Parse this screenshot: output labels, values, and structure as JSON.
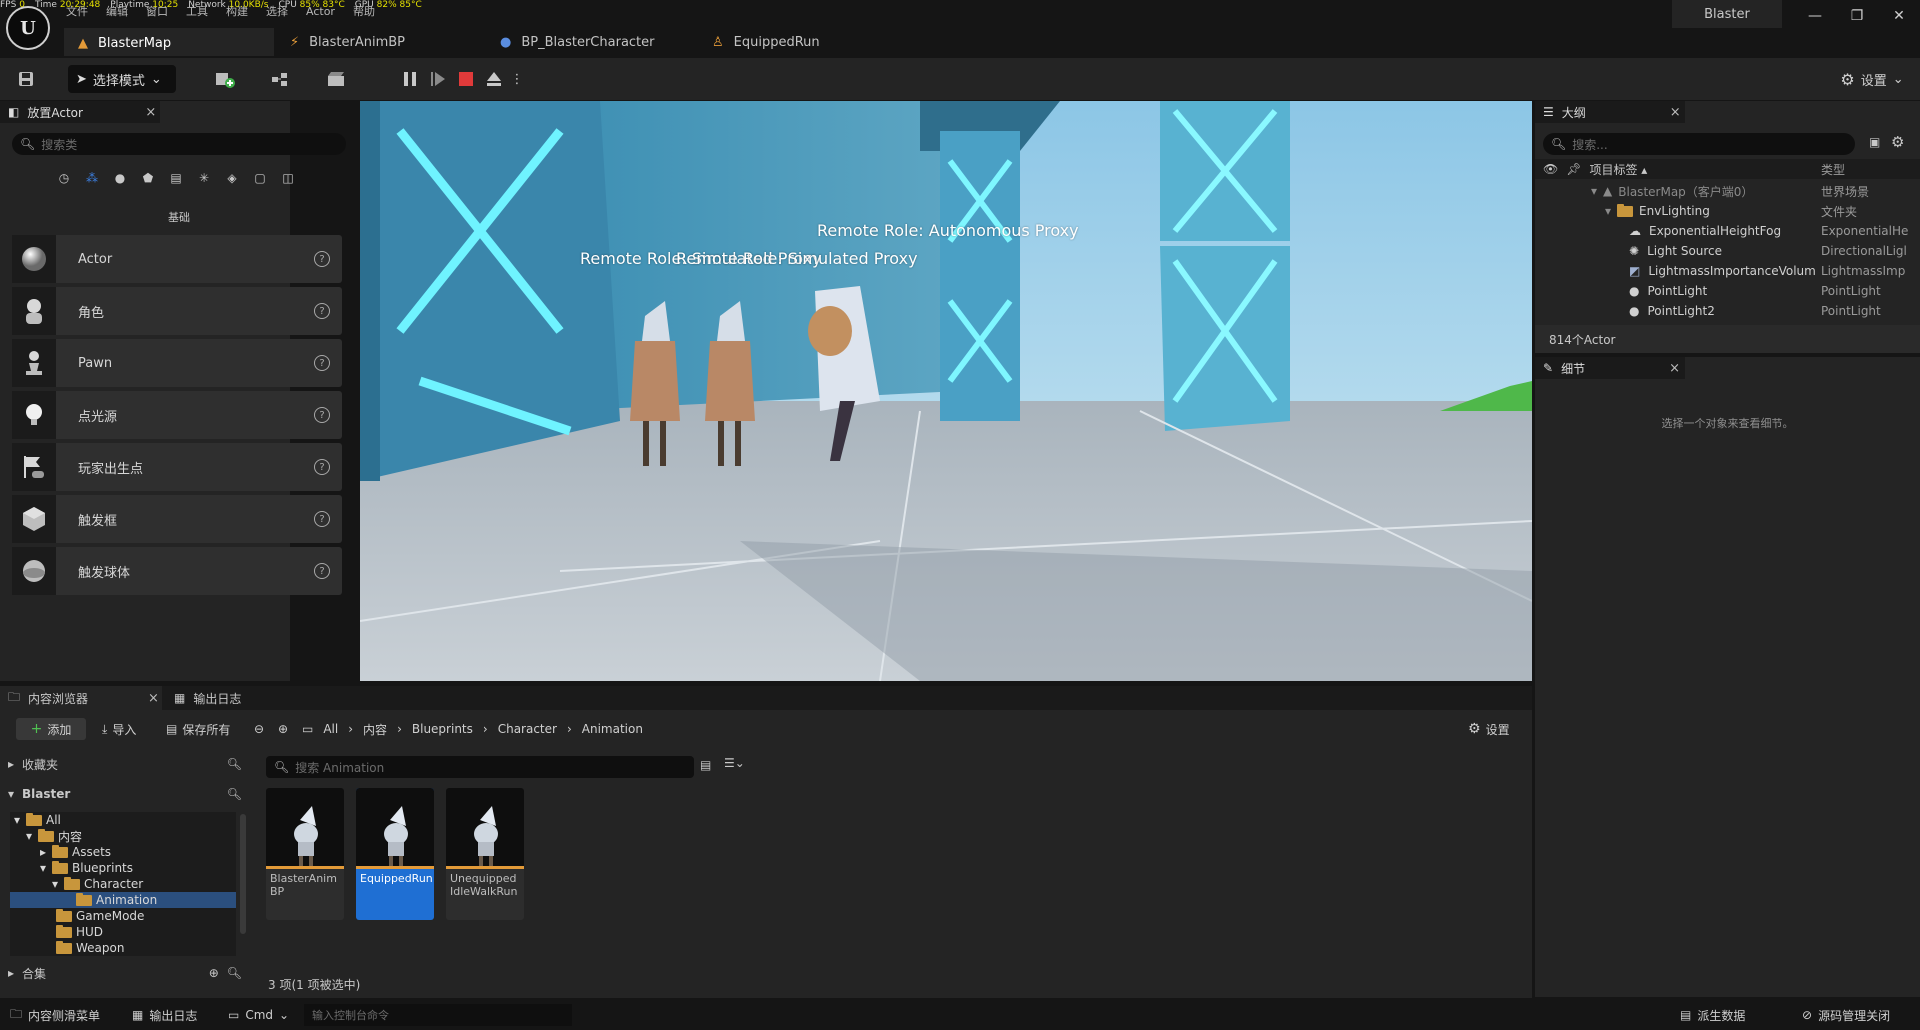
{
  "stats": [
    {
      "label": "FPS",
      "value": "0"
    },
    {
      "label": "Time",
      "value": "20:29:48"
    },
    {
      "label": "Playtime",
      "value": "10:25"
    },
    {
      "label": "Network",
      "value": "10.0KB/s"
    },
    {
      "label": "CPU",
      "value": "85% 83°C"
    },
    {
      "label": "GPU",
      "value": "82% 85°C"
    }
  ],
  "menu": [
    "文件",
    "编辑",
    "窗口",
    "工具",
    "构建",
    "选择",
    "Actor",
    "帮助"
  ],
  "project_name": "Blaster",
  "tabs": [
    {
      "label": "BlasterMap",
      "active": true
    },
    {
      "label": "BlasterAnimBP",
      "active": false
    },
    {
      "label": "BP_BlasterCharacter",
      "active": false
    },
    {
      "label": "EquippedRun",
      "active": false
    }
  ],
  "toolbar": {
    "mode_label": "选择模式",
    "settings_label": "设置"
  },
  "place_actors": {
    "title": "放置Actor",
    "search_placeholder": "搜索类",
    "category_label": "基础",
    "items": [
      {
        "label": "Actor",
        "icon": "sphere-icon"
      },
      {
        "label": "角色",
        "icon": "character-icon"
      },
      {
        "label": "Pawn",
        "icon": "pawn-icon"
      },
      {
        "label": "点光源",
        "icon": "light-bulb-icon"
      },
      {
        "label": "玩家出生点",
        "icon": "player-start-icon"
      },
      {
        "label": "触发框",
        "icon": "trigger-box-icon"
      },
      {
        "label": "触发球体",
        "icon": "trigger-sphere-icon"
      }
    ]
  },
  "viewport": {
    "labels": [
      "Remote Role: Autonomous Proxy",
      "Remote Role: Simulated Proxy",
      "Remote Role: Simulated Proxy"
    ]
  },
  "outliner": {
    "title": "大纲",
    "search_placeholder": "搜索...",
    "col_label": "项目标签 ▴",
    "col_type": "类型",
    "rows": [
      {
        "label": "BlasterMap（客户端0）",
        "type": "世界场景",
        "indent": 0,
        "icon": "map-icon"
      },
      {
        "label": "EnvLighting",
        "type": "文件夹",
        "indent": 1,
        "icon": "folder-icon"
      },
      {
        "label": "ExponentialHeightFog",
        "type": "ExponentialHe",
        "indent": 2,
        "icon": "fog-icon"
      },
      {
        "label": "Light Source",
        "type": "DirectionalLigl",
        "indent": 2,
        "icon": "sun-icon"
      },
      {
        "label": "LightmassImportanceVolum",
        "type": "LightmassImp",
        "indent": 2,
        "icon": "volume-icon"
      },
      {
        "label": "PointLight",
        "type": "PointLight",
        "indent": 2,
        "icon": "light-bulb-icon"
      },
      {
        "label": "PointLight2",
        "type": "PointLight",
        "indent": 2,
        "icon": "light-bulb-icon"
      }
    ],
    "actor_count": "814个Actor"
  },
  "details": {
    "title": "细节",
    "hint": "选择一个对象来查看细节。"
  },
  "content_browser": {
    "tab_label": "内容浏览器",
    "log_tab_label": "输出日志",
    "add_label": "添加",
    "import_label": "导入",
    "save_all_label": "保存所有",
    "breadcrumb": [
      "All",
      "内容",
      "Blueprints",
      "Character",
      "Animation"
    ],
    "settings_label": "设置",
    "favorites_label": "收藏夹",
    "project_label": "Blaster",
    "collections_label": "合集",
    "search_placeholder": "搜索 Animation",
    "tree": [
      {
        "label": "All",
        "indent": 0
      },
      {
        "label": "内容",
        "indent": 1
      },
      {
        "label": "Assets",
        "indent": 2
      },
      {
        "label": "Blueprints",
        "indent": 2
      },
      {
        "label": "Character",
        "indent": 3
      },
      {
        "label": "Animation",
        "indent": 4,
        "selected": true
      },
      {
        "label": "GameMode",
        "indent": 3
      },
      {
        "label": "HUD",
        "indent": 3
      },
      {
        "label": "Weapon",
        "indent": 3
      }
    ],
    "assets": [
      {
        "label": "BlasterAnim BP",
        "selected": false
      },
      {
        "label": "EquippedRun",
        "selected": true
      },
      {
        "label": "Unequipped IdleWalkRun",
        "selected": false
      }
    ],
    "status": "3 项(1 项被选中)"
  },
  "statusbar": {
    "drawer_label": "内容侧滑菜单",
    "log_label": "输出日志",
    "cmd_label": "Cmd",
    "console_placeholder": "输入控制台命令",
    "derived_label": "派生数据",
    "source_control_label": "源码管理关闭"
  },
  "colors": {
    "accent": "#1f6fd3",
    "panel": "#242424",
    "background": "#151515",
    "stat_value": "#e4e000",
    "folder": "#c8963c",
    "play_stop": "#e03a3a"
  }
}
